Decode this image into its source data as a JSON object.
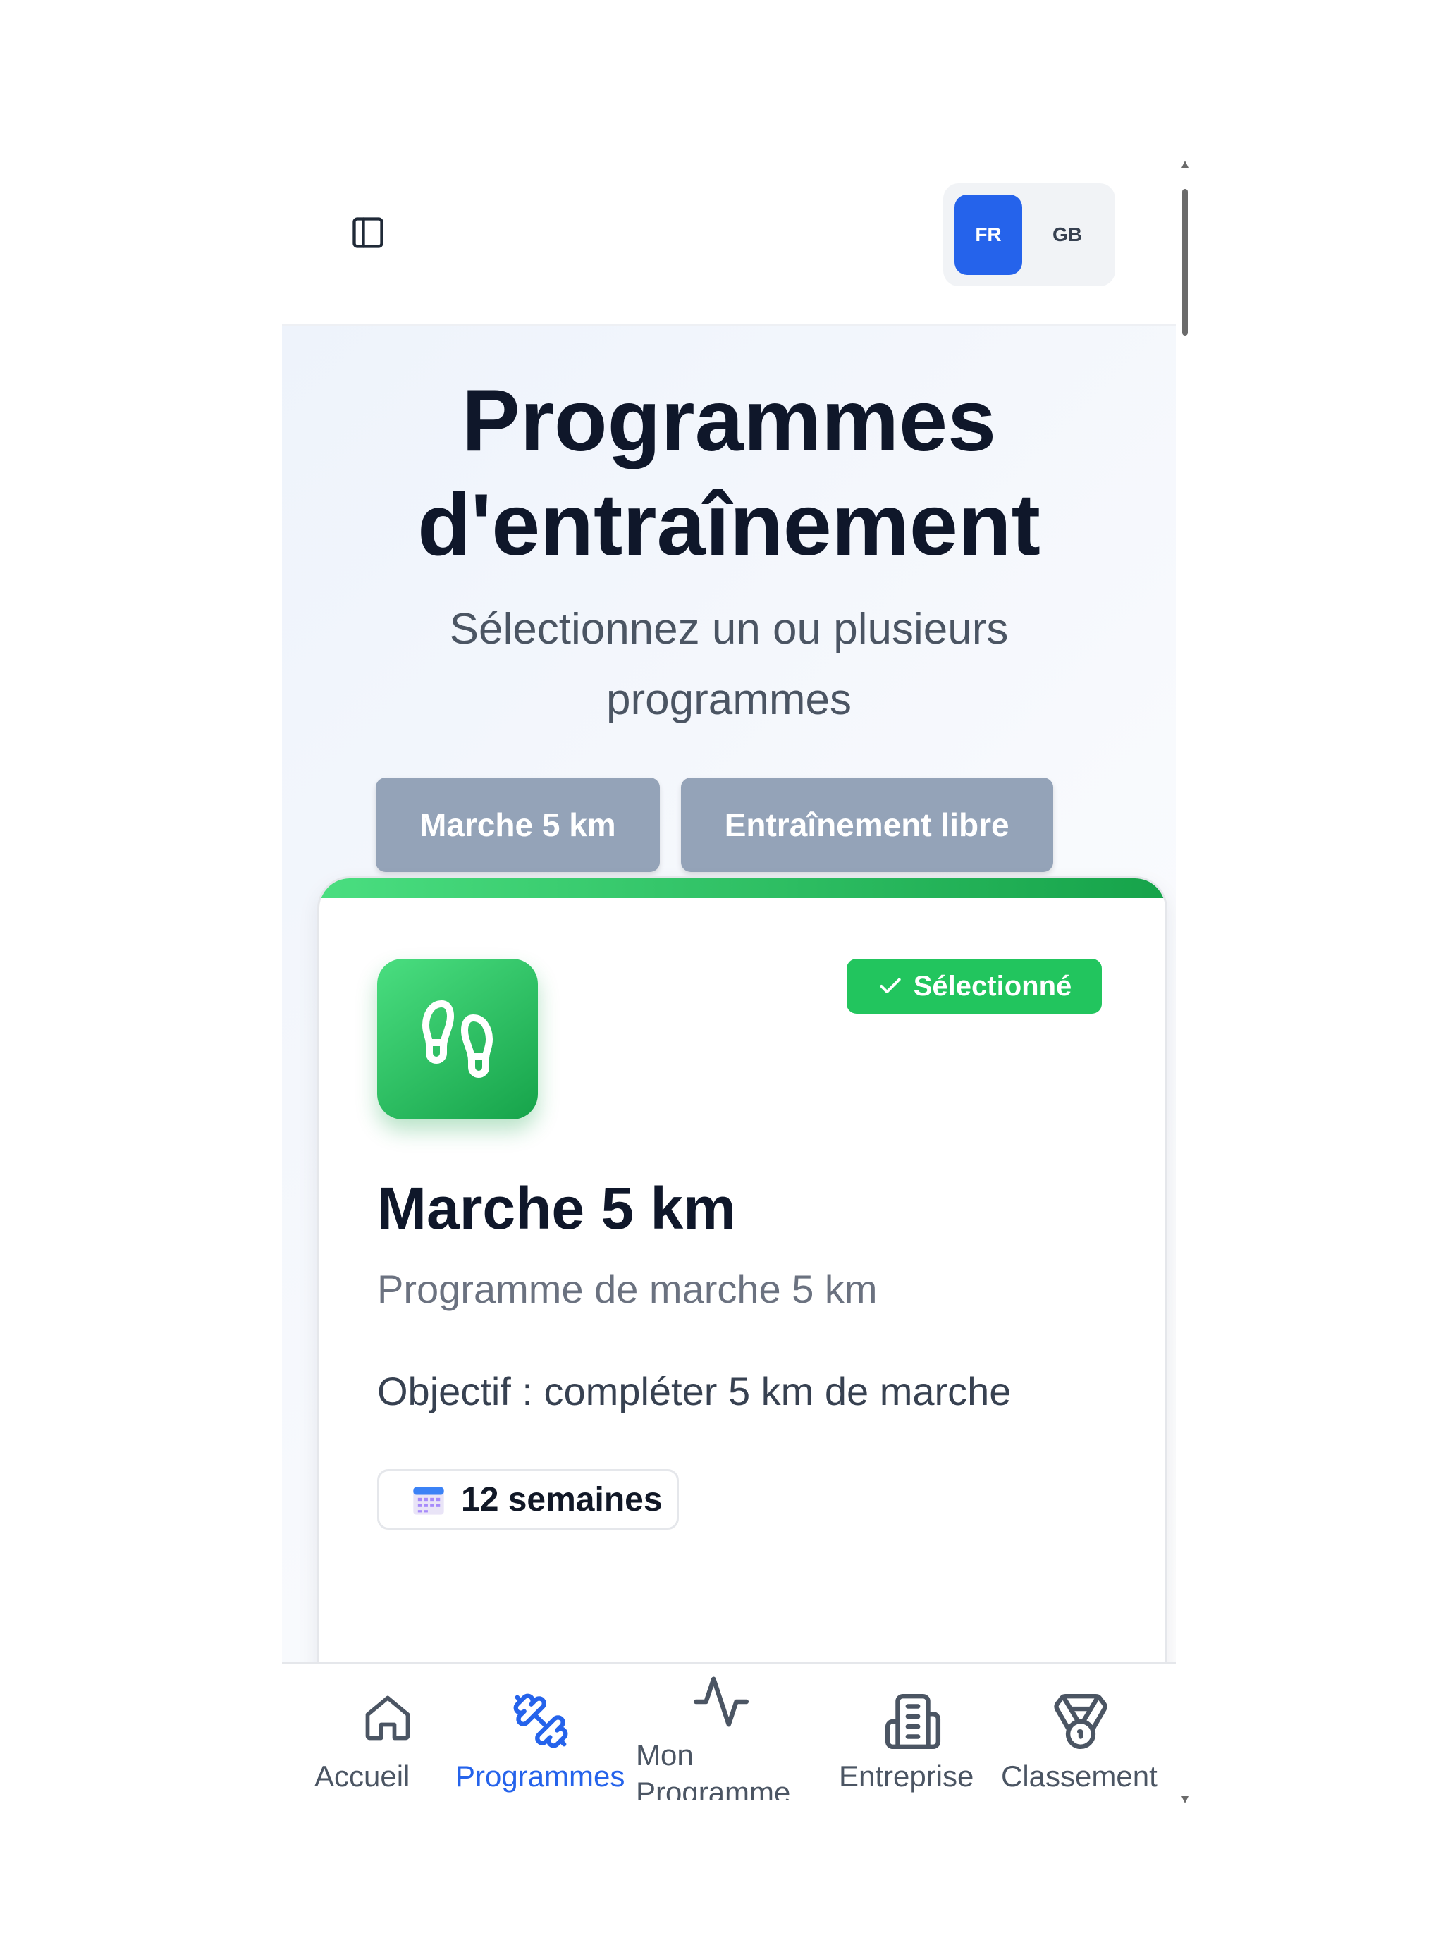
{
  "header": {
    "sidebar_toggle_icon": "sidebar-panel-icon",
    "languages": [
      {
        "code": "FR",
        "active": true
      },
      {
        "code": "GB",
        "active": false
      }
    ]
  },
  "hero": {
    "title_line1": "Programmes",
    "title_line2": "d'entraînement",
    "subtitle": "Sélectionnez un ou plusieurs programmes",
    "filters": [
      "Marche 5 km",
      "Entraînement libre"
    ]
  },
  "card": {
    "icon": "footprints-icon",
    "badge": "Sélectionné",
    "badge_icon": "check-icon",
    "title": "Marche 5 km",
    "description": "Programme de marche 5 km",
    "goal": "Objectif : compléter 5 km de marche",
    "duration_icon": "calendar-icon",
    "duration": "12 semaines"
  },
  "bottom_nav": {
    "items": [
      {
        "label": "Accueil",
        "icon": "home-icon",
        "active": false
      },
      {
        "label": "Programmes",
        "icon": "dumbbell-icon",
        "active": true
      },
      {
        "label_line1": "Mon",
        "label_line2": "Programme",
        "icon": "activity-icon",
        "active": false
      },
      {
        "label": "Entreprise",
        "icon": "building-icon",
        "active": false
      },
      {
        "label": "Classement",
        "icon": "medal-icon",
        "active": false
      }
    ]
  },
  "colors": {
    "primary": "#2563eb",
    "success": "#22c55e",
    "filter_button": "#94a3b8",
    "title": "#0f172a"
  }
}
